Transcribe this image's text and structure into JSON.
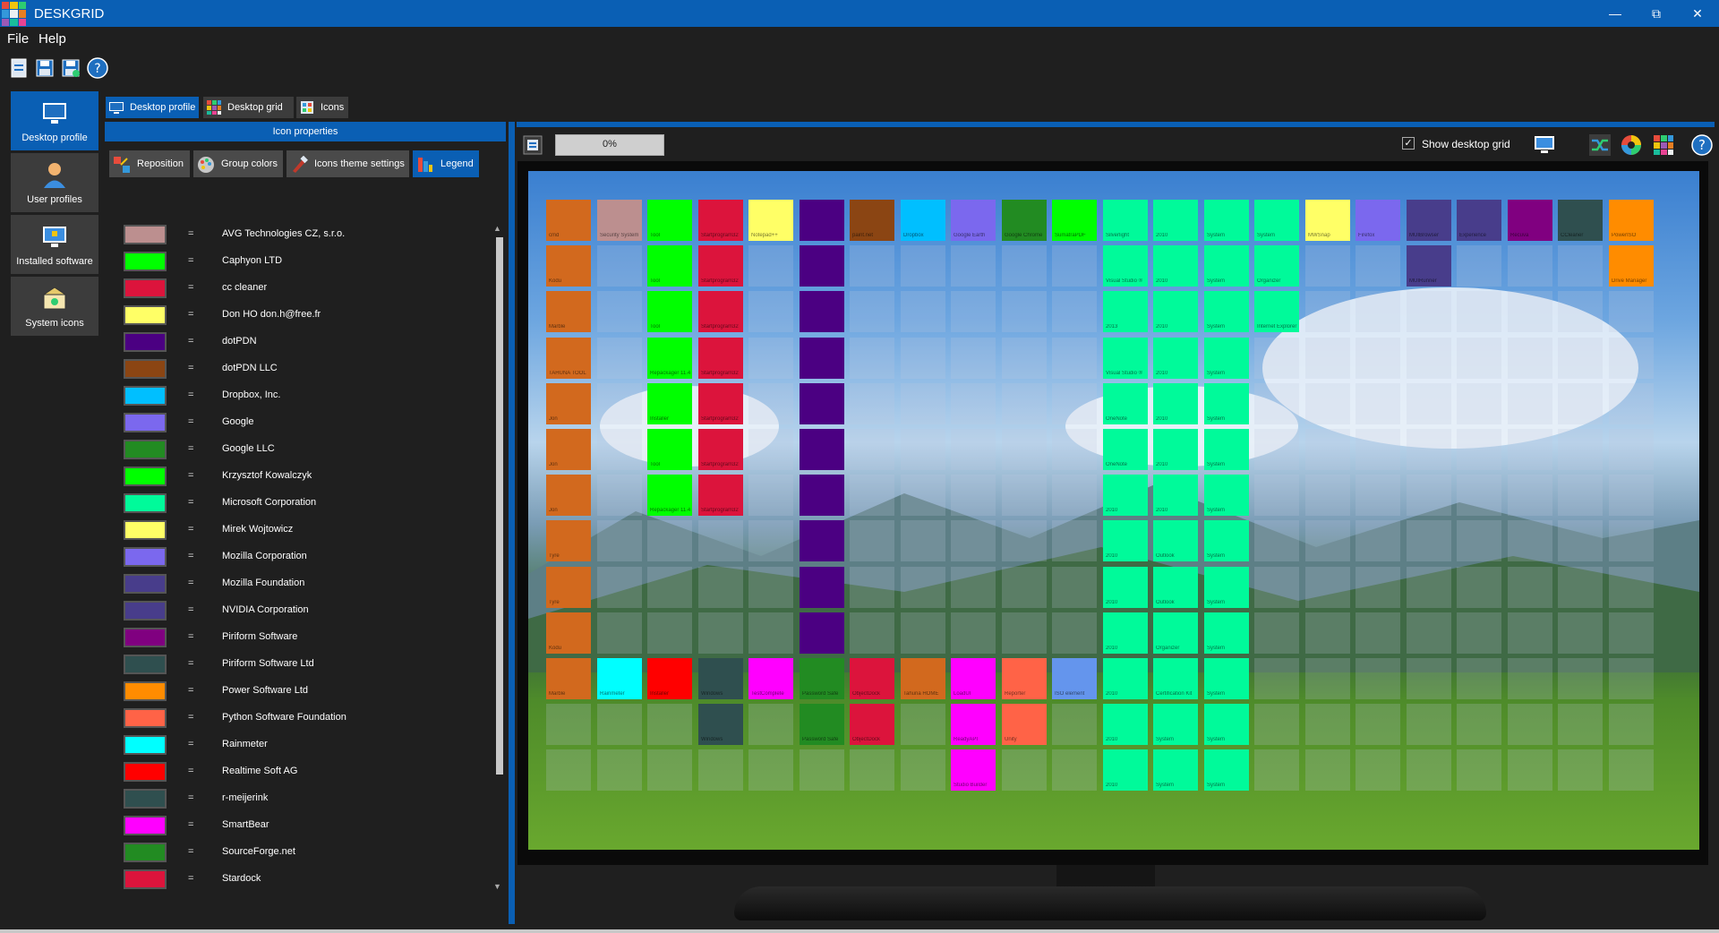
{
  "window": {
    "title": "DESKGRID",
    "minimize_icon": "minimize-icon",
    "restore_icon": "restore-icon",
    "close_icon": "close-icon"
  },
  "menu": {
    "file": "File",
    "help": "Help"
  },
  "toolbar": [
    {
      "name": "new-profile-button",
      "icon": "document-icon"
    },
    {
      "name": "save-button",
      "icon": "save-icon"
    },
    {
      "name": "save-as-button",
      "icon": "save-as-icon"
    },
    {
      "name": "help-button",
      "icon": "help-icon"
    }
  ],
  "nav": [
    {
      "label": "Desktop profile",
      "icon": "desktop-icon",
      "active": true
    },
    {
      "label": "User profiles",
      "icon": "user-icon",
      "active": false
    },
    {
      "label": "Installed software",
      "icon": "software-icon",
      "active": false
    },
    {
      "label": "System icons",
      "icon": "system-icons-icon",
      "active": false
    }
  ],
  "tabs": [
    {
      "label": "Desktop profile",
      "active": true
    },
    {
      "label": "Desktop grid",
      "active": false
    },
    {
      "label": "Icons",
      "active": false
    }
  ],
  "properties_header": "Icon properties",
  "subtabs": [
    {
      "label": "Reposition",
      "active": false
    },
    {
      "label": "Group colors",
      "active": false
    },
    {
      "label": "Icons theme settings",
      "active": false
    },
    {
      "label": "Legend",
      "active": true
    }
  ],
  "legend_separator": "=",
  "legend": [
    {
      "name": "AVG Technologies CZ, s.r.o.",
      "color": "#BC8F8F"
    },
    {
      "name": "Caphyon LTD",
      "color": "#00FF00"
    },
    {
      "name": "cc cleaner",
      "color": "#DC143C"
    },
    {
      "name": "Don HO don.h@free.fr",
      "color": "#FFFF66"
    },
    {
      "name": "dotPDN",
      "color": "#4B0082"
    },
    {
      "name": "dotPDN LLC",
      "color": "#8B4513"
    },
    {
      "name": "Dropbox, Inc.",
      "color": "#00BFFF"
    },
    {
      "name": "Google",
      "color": "#7B68EE"
    },
    {
      "name": "Google LLC",
      "color": "#228B22"
    },
    {
      "name": "Krzysztof Kowalczyk",
      "color": "#00FF00"
    },
    {
      "name": "Microsoft Corporation",
      "color": "#00FA9A"
    },
    {
      "name": "Mirek Wojtowicz",
      "color": "#FFFF66"
    },
    {
      "name": "Mozilla Corporation",
      "color": "#7B68EE"
    },
    {
      "name": "Mozilla Foundation",
      "color": "#483D8B"
    },
    {
      "name": "NVIDIA Corporation",
      "color": "#483D8B"
    },
    {
      "name": "Piriform Software",
      "color": "#800080"
    },
    {
      "name": "Piriform Software Ltd",
      "color": "#2F4F4F"
    },
    {
      "name": "Power Software Ltd",
      "color": "#FF8C00"
    },
    {
      "name": "Python Software Foundation",
      "color": "#FF6347"
    },
    {
      "name": "Rainmeter",
      "color": "#00FFFF"
    },
    {
      "name": "Realtime Soft AG",
      "color": "#FF0000"
    },
    {
      "name": "r-meijerink",
      "color": "#2F4F4F"
    },
    {
      "name": "SmartBear",
      "color": "#FF00FF"
    },
    {
      "name": "SourceForge.net",
      "color": "#228B22"
    },
    {
      "name": "Stardock",
      "color": "#DC143C"
    }
  ],
  "right_toolbar": {
    "progress_text": "0%",
    "progress_value": 0,
    "show_grid_label": "Show desktop grid",
    "show_grid_checked": true
  },
  "grid": {
    "columns": 22,
    "rows": 13,
    "icons": [
      [
        {
          "col": 0,
          "color": "#D2691E",
          "label": "cmd"
        },
        {
          "col": 1,
          "color": "#BC8F8F",
          "label": "Security System"
        },
        {
          "col": 2,
          "color": "#00FF00",
          "label": "Tool"
        },
        {
          "col": 3,
          "color": "#DC143C",
          "label": "Startprogram32"
        },
        {
          "col": 4,
          "color": "#FFFF66",
          "label": "Notepad++"
        },
        {
          "col": 5,
          "color": "#4B0082",
          "label": ""
        },
        {
          "col": 6,
          "color": "#8B4513",
          "label": "paint.net"
        },
        {
          "col": 7,
          "color": "#00BFFF",
          "label": "Dropbox"
        },
        {
          "col": 8,
          "color": "#7B68EE",
          "label": "Google Earth"
        },
        {
          "col": 9,
          "color": "#228B22",
          "label": "Google Chrome"
        },
        {
          "col": 10,
          "color": "#00FF00",
          "label": "SumatraPDF"
        },
        {
          "col": 11,
          "color": "#00FA9A",
          "label": "Silverlight"
        },
        {
          "col": 12,
          "color": "#00FA9A",
          "label": "2010"
        },
        {
          "col": 13,
          "color": "#00FA9A",
          "label": "System"
        },
        {
          "col": 14,
          "color": "#00FA9A",
          "label": "System"
        },
        {
          "col": 15,
          "color": "#FFFF66",
          "label": "MWSnap"
        },
        {
          "col": 16,
          "color": "#7B68EE",
          "label": "Firefox"
        },
        {
          "col": 17,
          "color": "#483D8B",
          "label": "MUIBrowser"
        },
        {
          "col": 18,
          "color": "#483D8B",
          "label": "Experience"
        },
        {
          "col": 19,
          "color": "#800080",
          "label": "Recuva"
        },
        {
          "col": 20,
          "color": "#2F4F4F",
          "label": "CCleaner"
        },
        {
          "col": 21,
          "color": "#FF8C00",
          "label": "PowerISO"
        }
      ],
      [
        {
          "col": 0,
          "color": "#D2691E",
          "label": "Kodu"
        },
        {
          "col": 2,
          "color": "#00FF00",
          "label": "Tool"
        },
        {
          "col": 3,
          "color": "#DC143C",
          "label": "Startprogram32"
        },
        {
          "col": 5,
          "color": "#4B0082",
          "label": ""
        },
        {
          "col": 11,
          "color": "#00FA9A",
          "label": "Visual Studio ®"
        },
        {
          "col": 12,
          "color": "#00FA9A",
          "label": "2010"
        },
        {
          "col": 13,
          "color": "#00FA9A",
          "label": "System"
        },
        {
          "col": 14,
          "color": "#00FA9A",
          "label": "Organizer"
        },
        {
          "col": 17,
          "color": "#483D8B",
          "label": "MUIRunner"
        },
        {
          "col": 21,
          "color": "#FF8C00",
          "label": "Drive Manager"
        }
      ],
      [
        {
          "col": 0,
          "color": "#D2691E",
          "label": "Marble"
        },
        {
          "col": 2,
          "color": "#00FF00",
          "label": "Tool"
        },
        {
          "col": 3,
          "color": "#DC143C",
          "label": "Startprogram32"
        },
        {
          "col": 5,
          "color": "#4B0082",
          "label": ""
        },
        {
          "col": 11,
          "color": "#00FA9A",
          "label": "2013"
        },
        {
          "col": 12,
          "color": "#00FA9A",
          "label": "2010"
        },
        {
          "col": 13,
          "color": "#00FA9A",
          "label": "System"
        },
        {
          "col": 14,
          "color": "#00FA9A",
          "label": "Internet Explorer"
        }
      ],
      [
        {
          "col": 0,
          "color": "#D2691E",
          "label": "TAHUNA TOOL"
        },
        {
          "col": 2,
          "color": "#00FF00",
          "label": "Repackager 11.4"
        },
        {
          "col": 3,
          "color": "#DC143C",
          "label": "Startprogram32"
        },
        {
          "col": 5,
          "color": "#4B0082",
          "label": ""
        },
        {
          "col": 11,
          "color": "#00FA9A",
          "label": "Visual Studio ®"
        },
        {
          "col": 12,
          "color": "#00FA9A",
          "label": "2010"
        },
        {
          "col": 13,
          "color": "#00FA9A",
          "label": "System"
        }
      ],
      [
        {
          "col": 0,
          "color": "#D2691E",
          "label": "Jon"
        },
        {
          "col": 2,
          "color": "#00FF00",
          "label": "Installer"
        },
        {
          "col": 3,
          "color": "#DC143C",
          "label": "Startprogram32"
        },
        {
          "col": 5,
          "color": "#4B0082",
          "label": ""
        },
        {
          "col": 11,
          "color": "#00FA9A",
          "label": "OneNote"
        },
        {
          "col": 12,
          "color": "#00FA9A",
          "label": "2010"
        },
        {
          "col": 13,
          "color": "#00FA9A",
          "label": "System"
        }
      ],
      [
        {
          "col": 0,
          "color": "#D2691E",
          "label": "Jon"
        },
        {
          "col": 2,
          "color": "#00FF00",
          "label": "Tool"
        },
        {
          "col": 3,
          "color": "#DC143C",
          "label": "Startprogram32"
        },
        {
          "col": 5,
          "color": "#4B0082",
          "label": ""
        },
        {
          "col": 11,
          "color": "#00FA9A",
          "label": "OneNote"
        },
        {
          "col": 12,
          "color": "#00FA9A",
          "label": "2010"
        },
        {
          "col": 13,
          "color": "#00FA9A",
          "label": "System"
        }
      ],
      [
        {
          "col": 0,
          "color": "#D2691E",
          "label": "Jon"
        },
        {
          "col": 2,
          "color": "#00FF00",
          "label": "Repackager 11.4"
        },
        {
          "col": 3,
          "color": "#DC143C",
          "label": "Startprogram32"
        },
        {
          "col": 5,
          "color": "#4B0082",
          "label": ""
        },
        {
          "col": 11,
          "color": "#00FA9A",
          "label": "2010"
        },
        {
          "col": 12,
          "color": "#00FA9A",
          "label": "2010"
        },
        {
          "col": 13,
          "color": "#00FA9A",
          "label": "System"
        }
      ],
      [
        {
          "col": 0,
          "color": "#D2691E",
          "label": "Tyre"
        },
        {
          "col": 5,
          "color": "#4B0082",
          "label": ""
        },
        {
          "col": 11,
          "color": "#00FA9A",
          "label": "2010"
        },
        {
          "col": 12,
          "color": "#00FA9A",
          "label": "Outlook"
        },
        {
          "col": 13,
          "color": "#00FA9A",
          "label": "System"
        }
      ],
      [
        {
          "col": 0,
          "color": "#D2691E",
          "label": "Tyre"
        },
        {
          "col": 5,
          "color": "#4B0082",
          "label": ""
        },
        {
          "col": 11,
          "color": "#00FA9A",
          "label": "2010"
        },
        {
          "col": 12,
          "color": "#00FA9A",
          "label": "Outlook"
        },
        {
          "col": 13,
          "color": "#00FA9A",
          "label": "System"
        }
      ],
      [
        {
          "col": 0,
          "color": "#D2691E",
          "label": "Kodu"
        },
        {
          "col": 5,
          "color": "#4B0082",
          "label": ""
        },
        {
          "col": 11,
          "color": "#00FA9A",
          "label": "2010"
        },
        {
          "col": 12,
          "color": "#00FA9A",
          "label": "Organizer"
        },
        {
          "col": 13,
          "color": "#00FA9A",
          "label": "System"
        }
      ],
      [
        {
          "col": 0,
          "color": "#D2691E",
          "label": "Marble"
        },
        {
          "col": 1,
          "color": "#00FFFF",
          "label": "Rainmeter"
        },
        {
          "col": 2,
          "color": "#FF0000",
          "label": "Installer"
        },
        {
          "col": 3,
          "color": "#2F4F4F",
          "label": "Windows"
        },
        {
          "col": 4,
          "color": "#FF00FF",
          "label": "TestComplete"
        },
        {
          "col": 5,
          "color": "#228B22",
          "label": "Password Safe"
        },
        {
          "col": 6,
          "color": "#DC143C",
          "label": "ObjectDock"
        },
        {
          "col": 7,
          "color": "#D2691E",
          "label": "Tahuna HOME"
        },
        {
          "col": 8,
          "color": "#FF00FF",
          "label": "LoadUI"
        },
        {
          "col": 9,
          "color": "#FF6347",
          "label": "Reporter"
        },
        {
          "col": 10,
          "color": "#6495ED",
          "label": "ISO element"
        },
        {
          "col": 11,
          "color": "#00FA9A",
          "label": "2010"
        },
        {
          "col": 12,
          "color": "#00FA9A",
          "label": "Certification Kit"
        },
        {
          "col": 13,
          "color": "#00FA9A",
          "label": "System"
        }
      ],
      [
        {
          "col": 3,
          "color": "#2F4F4F",
          "label": "Windows"
        },
        {
          "col": 5,
          "color": "#228B22",
          "label": "Password Safe"
        },
        {
          "col": 6,
          "color": "#DC143C",
          "label": "ObjectDock"
        },
        {
          "col": 8,
          "color": "#FF00FF",
          "label": "ReadyAPI"
        },
        {
          "col": 9,
          "color": "#FF6347",
          "label": "Unity"
        },
        {
          "col": 11,
          "color": "#00FA9A",
          "label": "2010"
        },
        {
          "col": 12,
          "color": "#00FA9A",
          "label": "System"
        },
        {
          "col": 13,
          "color": "#00FA9A",
          "label": "System"
        }
      ],
      [
        {
          "col": 8,
          "color": "#FF00FF",
          "label": "Studio Builder"
        },
        {
          "col": 11,
          "color": "#00FA9A",
          "label": "2010"
        },
        {
          "col": 12,
          "color": "#00FA9A",
          "label": "System"
        },
        {
          "col": 13,
          "color": "#00FA9A",
          "label": "System"
        }
      ]
    ]
  }
}
